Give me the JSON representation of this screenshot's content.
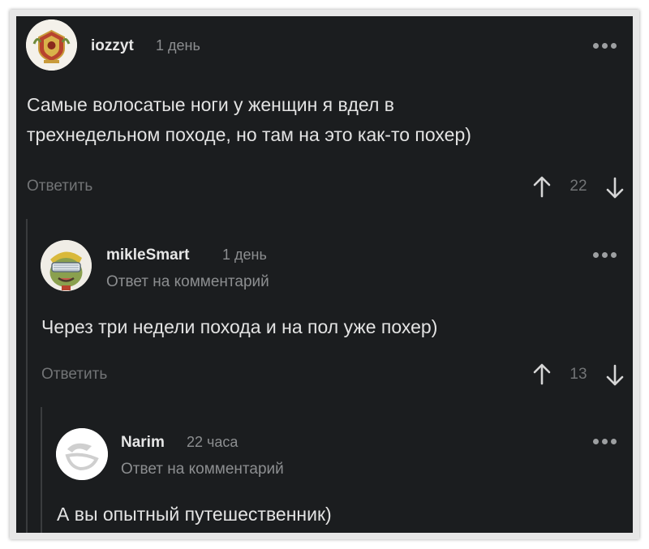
{
  "comments": [
    {
      "username": "iozzyt",
      "time": "1 день",
      "text_lines": [
        "Самые волосатые ноги у женщин я вдел в",
        "трехнедельном походе, но там на это как-то похер)"
      ],
      "reply_label": "Ответить",
      "score": "22",
      "avatar": "crest-avatar"
    },
    {
      "username": "mikleSmart",
      "time": "1 день",
      "reply_to": "Ответ на комментарий",
      "text_lines": [
        "Через три недели похода и на пол уже похер)"
      ],
      "reply_label": "Ответить",
      "score": "13",
      "avatar": "cartoon-avatar"
    },
    {
      "username": "Narim",
      "time": "22 часа",
      "reply_to": "Ответ на комментарий",
      "text_lines": [
        "А вы опытный путешественник)"
      ],
      "avatar": "default-avatar"
    }
  ],
  "colors": {
    "background": "#1b1d1f",
    "text": "#e3e3e3",
    "muted": "#8c8e90",
    "thread_line": "#3a3c3e"
  }
}
